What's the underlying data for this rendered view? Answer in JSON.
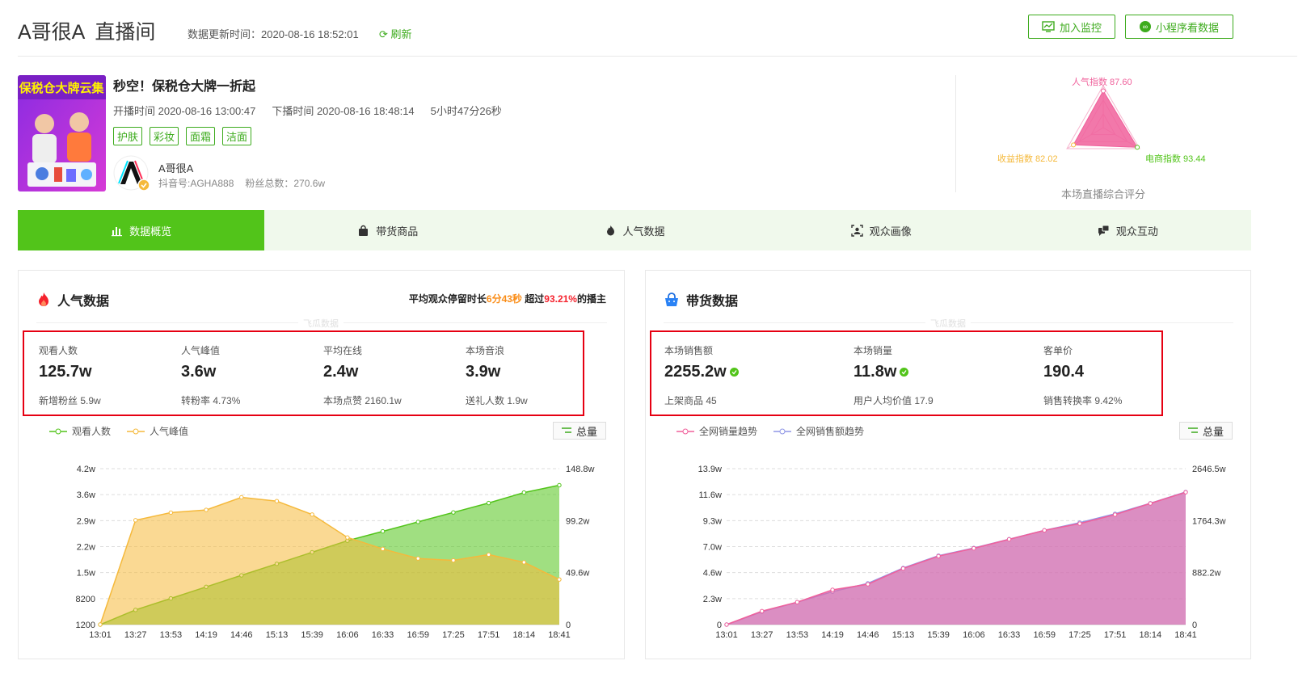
{
  "header": {
    "title": "A哥很A",
    "subtitle": "直播间",
    "update_label": "数据更新时间：2020-08-16 18:52:01",
    "refresh_label": "刷新",
    "monitor_label": "加入监控",
    "mini_label": "小程序看数据"
  },
  "live": {
    "cover_text": "保税仓大牌云集",
    "title": "秒空！保税仓大牌一折起",
    "start": "开播时间 2020-08-16 13:00:47",
    "end": "下播时间 2020-08-16 18:48:14",
    "duration": "5小时47分26秒",
    "tags": [
      "护肤",
      "彩妆",
      "面霜",
      "洁面"
    ],
    "anchor_name": "A哥很A",
    "douyin_id": "抖音号:AGHA888",
    "fans": "粉丝总数：270.6w"
  },
  "radar": {
    "popularity": "人气指数 87.60",
    "income": "收益指数 82.02",
    "ecommerce": "电商指数 93.44",
    "caption": "本场直播综合评分",
    "scores": [
      87.6,
      93.44,
      82.02
    ],
    "colors": {
      "popularity": "#f0609b",
      "income": "#f5b93b",
      "ecommerce": "#52c41a"
    }
  },
  "tabs": [
    {
      "label": "数据概览",
      "icon": "bar-chart-icon"
    },
    {
      "label": "带货商品",
      "icon": "shopping-bag-icon"
    },
    {
      "label": "人气数据",
      "icon": "flame-icon"
    },
    {
      "label": "观众画像",
      "icon": "face-scan-icon"
    },
    {
      "label": "观众互动",
      "icon": "chat-icon"
    }
  ],
  "popularity": {
    "title": "人气数据",
    "stay": {
      "prefix": "平均观众停留时长",
      "time": "6分43秒",
      "mid": " 超过",
      "percent": "93.21%",
      "suffix": "的播主"
    },
    "watermark": "飞瓜数据",
    "stats": [
      {
        "label": "观看人数",
        "value": "125.7w",
        "sub": "新增粉丝 5.9w"
      },
      {
        "label": "人气峰值",
        "value": "3.6w",
        "sub": "转粉率 4.73%"
      },
      {
        "label": "平均在线",
        "value": "2.4w",
        "sub": "本场点赞 2160.1w"
      },
      {
        "label": "本场音浪",
        "value": "3.9w",
        "sub": "送礼人数 1.9w"
      }
    ],
    "legend": [
      "观看人数",
      "人气峰值"
    ],
    "total_label": "总量"
  },
  "sales": {
    "title": "带货数据",
    "watermark": "飞瓜数据",
    "stats": [
      {
        "label": "本场销售额",
        "value": "2255.2w",
        "sub": "上架商品 45",
        "verified": true
      },
      {
        "label": "本场销量",
        "value": "11.8w",
        "sub": "用户人均价值 17.9",
        "verified": true
      },
      {
        "label": "客单价",
        "value": "190.4",
        "sub": "销售转换率 9.42%",
        "verified": false
      }
    ],
    "legend": [
      "全网销量趋势",
      "全网销售额趋势"
    ],
    "total_label": "总量"
  },
  "chart_data": [
    {
      "type": "area",
      "x": [
        "13:01",
        "13:27",
        "13:53",
        "14:19",
        "14:46",
        "15:13",
        "15:39",
        "16:06",
        "16:33",
        "16:59",
        "17:25",
        "17:51",
        "18:14",
        "18:41"
      ],
      "left_ticks": [
        "1200",
        "8200",
        "1.5w",
        "2.2w",
        "2.9w",
        "3.6w",
        "4.2w"
      ],
      "right_ticks": [
        "0",
        "49.6w",
        "99.2w",
        "148.8w"
      ],
      "ylim": [
        0.12,
        4.2
      ],
      "y2lim": [
        0,
        148.8
      ],
      "colors": {
        "peak": "#f5b93b",
        "viewers": "#52c41a"
      },
      "series": [
        {
          "name": "人气峰值",
          "axis": "left",
          "values": [
            0.12,
            2.85,
            3.05,
            3.12,
            3.45,
            3.35,
            3.0,
            2.4,
            2.1,
            1.85,
            1.8,
            1.95,
            1.75,
            1.3
          ]
        },
        {
          "name": "观看人数",
          "axis": "right",
          "values": [
            0,
            14,
            25,
            36,
            47,
            58,
            69,
            80,
            89,
            98,
            107,
            116,
            126,
            133
          ]
        }
      ]
    },
    {
      "type": "area",
      "x": [
        "13:01",
        "13:27",
        "13:53",
        "14:19",
        "14:46",
        "15:13",
        "15:39",
        "16:06",
        "16:33",
        "16:59",
        "17:25",
        "17:51",
        "18:14",
        "18:41"
      ],
      "left_ticks": [
        "0",
        "2.3w",
        "4.6w",
        "7.0w",
        "9.3w",
        "11.6w",
        "13.9w"
      ],
      "right_ticks": [
        "0",
        "882.2w",
        "1764.3w",
        "2646.5w"
      ],
      "ylim": [
        0,
        13.9
      ],
      "y2lim": [
        0,
        2646.5
      ],
      "colors": {
        "volume": "#f0609b",
        "amount": "#8f96e6"
      },
      "series": [
        {
          "name": "全网销量趋势",
          "axis": "left",
          "values": [
            0,
            1.2,
            2.0,
            3.1,
            3.6,
            5.0,
            6.1,
            6.8,
            7.6,
            8.4,
            9.0,
            9.8,
            10.8,
            11.8
          ]
        },
        {
          "name": "全网销售额趋势",
          "axis": "right",
          "values": [
            0,
            220,
            380,
            560,
            700,
            960,
            1170,
            1300,
            1450,
            1600,
            1730,
            1880,
            2060,
            2250
          ]
        }
      ]
    }
  ]
}
